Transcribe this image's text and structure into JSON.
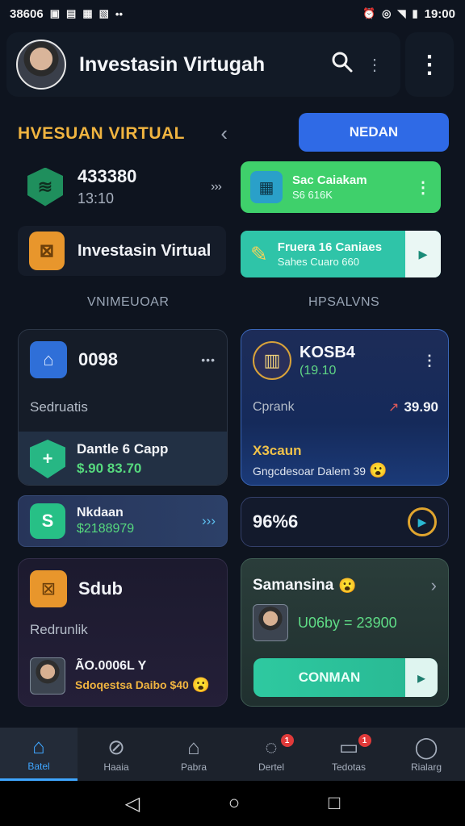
{
  "status_bar": {
    "left_text": "38606",
    "left_icons": [
      "notification-icon",
      "photo-icon",
      "sim-icon",
      "news-icon",
      "dots-icon"
    ],
    "right_icons": [
      "alarm-icon",
      "sync-icon",
      "wifi-icon",
      "signal-icon"
    ],
    "time": "19:00"
  },
  "app_bar": {
    "title": "Investasin Virtugah",
    "search_icon": "search-icon",
    "more_icon": "more-vertical-icon"
  },
  "section": {
    "title": "HVESUAN VIRTUAL",
    "chevron": "‹",
    "button_label": "NEDAN"
  },
  "row1": {
    "value": "433380",
    "sub": "13:10",
    "arrows": "›››"
  },
  "pill_green": {
    "title": "Sac Caiakam",
    "sub": "S6 616K",
    "menu": "⋮"
  },
  "invest_row": {
    "label": "Investasin Virtual"
  },
  "pill_teal": {
    "title": "Fruera 16 Caniaes",
    "sub": "Sahes Cuaro 660",
    "arrow": "▸"
  },
  "dividers": {
    "left": "VNIMEUOAR",
    "right": "HPSALVNS"
  },
  "card1": {
    "value": "0098",
    "dots": "•••",
    "caption": "Sedruatis",
    "panel_title": "Dantle 6 Capp",
    "panel_value": "$.90 83.70"
  },
  "card2": {
    "title": "KOSB4",
    "sub": "(19.10",
    "menu": "⋮",
    "label": "Cprank",
    "value": "39.90",
    "trend": "↗",
    "footer_title": "X3caun",
    "footer_text": "Gngcdesoar Dalem 39",
    "emoji": "😮"
  },
  "card3": {
    "title": "Nkdaan",
    "value": "$2188979",
    "arrows": "›››"
  },
  "card4": {
    "value": "96%6"
  },
  "card5": {
    "title": "Sdub",
    "caption": "Redrunlik",
    "value": "ÃO.0006L Y",
    "footer": "Sdoqestsa Daibo $40",
    "emoji": "😮"
  },
  "card6": {
    "title": "Samansina",
    "emoji": "😮",
    "chevron": "›",
    "value": "U06by = 23900",
    "cta_label": "CONMAN",
    "cta_arrow": "▸"
  },
  "bottom_nav": [
    {
      "label": "Batel",
      "icon": "home-icon",
      "active": true
    },
    {
      "label": "Haaia",
      "icon": "compass-icon",
      "active": false
    },
    {
      "label": "Pabra",
      "icon": "house-icon",
      "active": false
    },
    {
      "label": "Dertel",
      "icon": "chat-icon",
      "active": false,
      "badge": "1"
    },
    {
      "label": "Tedotas",
      "icon": "wallet-icon",
      "active": false,
      "badge": "1"
    },
    {
      "label": "Rialarg",
      "icon": "user-icon",
      "active": false
    }
  ],
  "system_nav": {
    "back": "◁",
    "home": "○",
    "recents": "□"
  },
  "colors": {
    "background": "#0e141f",
    "accent_blue": "#2f6ae6",
    "accent_green": "#3fd06b",
    "accent_teal": "#2fc4a8",
    "accent_orange": "#f0b440"
  }
}
